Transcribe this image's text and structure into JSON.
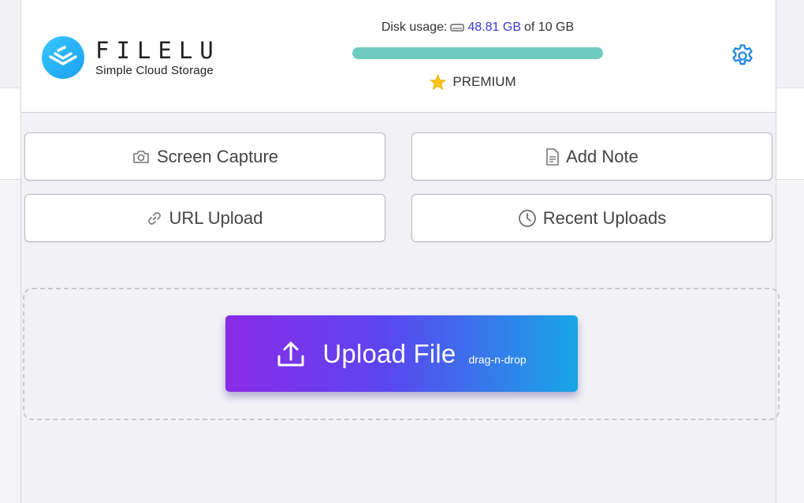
{
  "app": {
    "name": "FILELU",
    "tagline": "Simple Cloud Storage"
  },
  "disk": {
    "label": "Disk usage:",
    "used": "48.81 GB",
    "total_text": "of 10 GB",
    "bar_fill_fraction": 1.0,
    "bar_color": "#6ccbbd"
  },
  "plan": {
    "label": "PREMIUM",
    "icon": "star-icon"
  },
  "actions": {
    "screen_capture": "Screen Capture",
    "add_note": "Add Note",
    "url_upload": "URL Upload",
    "recent_uploads": "Recent Uploads"
  },
  "upload": {
    "label": "Upload File",
    "sub_label": "drag-n-drop"
  },
  "icons": {
    "settings": "gear-icon",
    "camera": "camera-icon",
    "note": "document-icon",
    "link": "link-icon",
    "clock": "clock-icon",
    "upload": "upload-icon",
    "disk": "hard-drive-icon"
  },
  "colors": {
    "accent_blue": "#1e88e5",
    "upload_gradient_start": "#8a2be6",
    "upload_gradient_end": "#17a6e6",
    "used_text": "#3b3bd6",
    "star": "#f5c518"
  }
}
